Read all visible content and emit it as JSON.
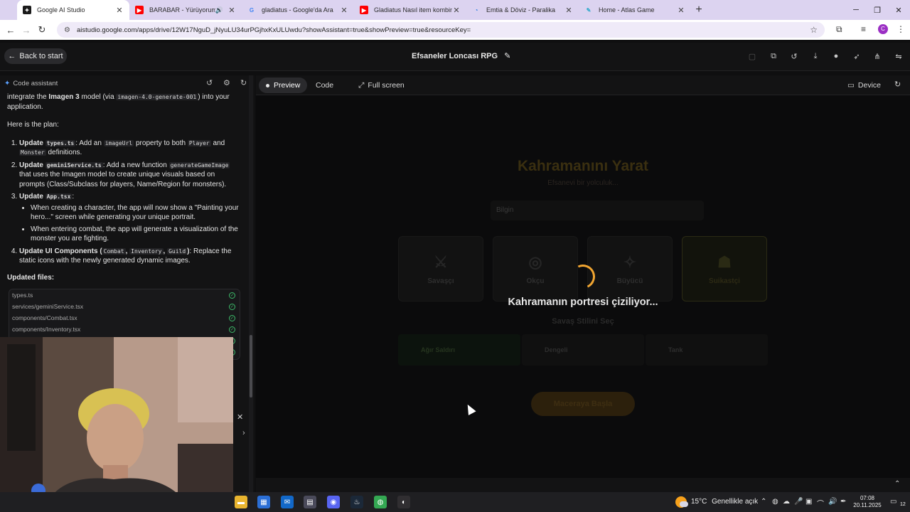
{
  "browser": {
    "tabs": [
      {
        "label": "Google AI Studio",
        "active": true,
        "fav": "AI",
        "fav_color": "#1a1a1a"
      },
      {
        "label": "BARABAR - Yürüyorum Dik...",
        "active": false,
        "fav": "▶",
        "fav_color": "#ff0000"
      },
      {
        "label": "gladiatus - Google'da Ara",
        "active": false,
        "fav": "G",
        "fav_color": "#4285f4"
      },
      {
        "label": "Gladiatus Nasıl item kombini ya...",
        "active": false,
        "fav": "▶",
        "fav_color": "#ff0000"
      },
      {
        "label": "Emtia & Döviz - Paralika",
        "active": false,
        "fav": "◔",
        "fav_color": "#2a7de1"
      },
      {
        "label": "Home - Atlas Game",
        "active": false,
        "fav": "✎",
        "fav_color": "#33aacc"
      }
    ],
    "url": "aistudio.google.com/apps/drive/12W17NguD_jNyuLU34urPGjhxKxULUwdu?showAssistant=true&showPreview=true&resourceKey="
  },
  "app": {
    "back_label": "Back to start",
    "project_title": "Efsaneler Loncası RPG"
  },
  "assistant": {
    "header": "Code assistant",
    "intro_before": "integrate the ",
    "intro_model": "Imagen 3",
    "intro_mid": " model (via ",
    "intro_code": "imagen-4.0-generate-001",
    "intro_after": ") into your application.",
    "plan_heading": "Here is the plan:",
    "steps": {
      "s1_bold": "Update ",
      "s1_code": "types.ts",
      "s1_text": ": Add an ",
      "s1_code2": "imageUrl",
      "s1_text2": " property to both ",
      "s1_code3": "Player",
      "s1_text3": " and ",
      "s1_code4": "Monster",
      "s1_text4": " definitions.",
      "s2_bold": "Update ",
      "s2_code": "geminiService.ts",
      "s2_text": ": Add a new function ",
      "s2_code2": "generateGameImage",
      "s2_text2": " that uses the Imagen model to create unique visuals based on prompts (Class/Subclass for players, Name/Region for monsters).",
      "s3_bold": "Update ",
      "s3_code": "App.tsx",
      "s3_text": ":",
      "s3_sub1": "When creating a character, the app will now show a \"Painting your hero...\" screen while generating your unique portrait.",
      "s3_sub2": "When entering combat, the app will generate a visualization of the monster you are fighting.",
      "s4_bold": "Update UI Components (",
      "s4_code": "Combat",
      "s4_sep1": ", ",
      "s4_code2": "Inventory",
      "s4_sep2": ", ",
      "s4_code3": "Guild",
      "s4_bold_end": ")",
      "s4_text": ": Replace the static icons with the newly generated dynamic images."
    },
    "updated_files_label": "Updated files:",
    "files": [
      "types.ts",
      "services/geminiService.tsx",
      "components/Combat.tsx",
      "components/Inventory.tsx"
    ]
  },
  "preview_toolbar": {
    "preview": "Preview",
    "code": "Code",
    "fullscreen": "Full screen",
    "device": "Device"
  },
  "preview": {
    "ghost_title": "Kahramanını Yarat",
    "ghost_subtitle": "Efsanevi bir yolculuk...",
    "ghost_input": "Bilgin",
    "classes": [
      "Savaşçı",
      "Okçu",
      "Büyücü",
      "Suikastçi"
    ],
    "style_heading": "Savaş Stilini Seç",
    "styles": [
      "Ağır Saldırı",
      "Dengeli",
      "Tank"
    ],
    "ghost_button": "Maceraya Başla",
    "loading_text": "Kahramanın portresi çiziliyor..."
  },
  "taskbar": {
    "temperature": "15°C",
    "weather": "Genellikle açık",
    "time": "07:08",
    "date": "20.11.2025",
    "notifications": "12"
  },
  "colors": {
    "spinner": "#f0a531",
    "background": "#0b0b0c"
  }
}
